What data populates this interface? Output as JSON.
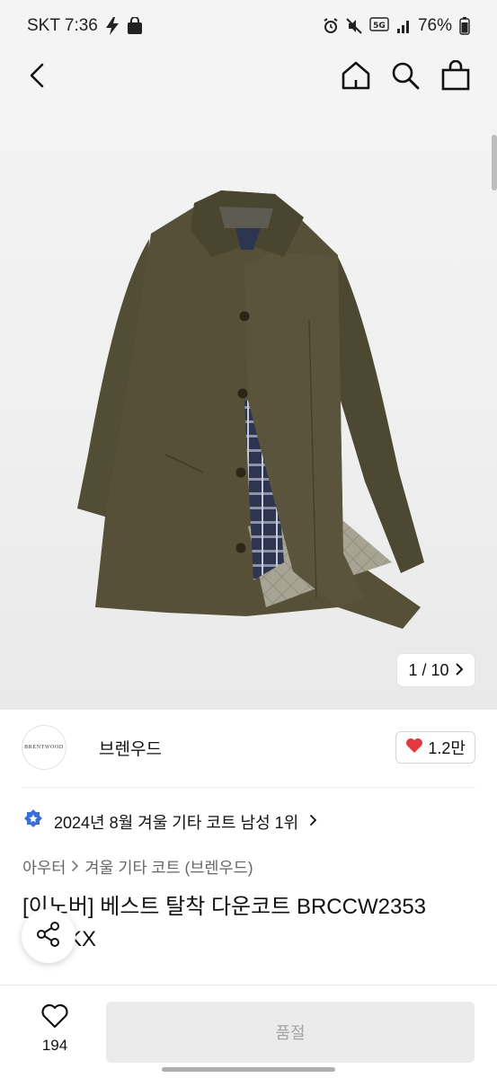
{
  "status_bar": {
    "carrier_time": "SKT 7:36",
    "battery": "76%",
    "icons": [
      "charging-bolt-icon",
      "bag-icon",
      "alarm-icon",
      "mute-icon",
      "5g-icon",
      "signal-icon",
      "battery-icon"
    ]
  },
  "nav": {
    "back_icon": "chevron-left-icon",
    "home_icon": "home-icon",
    "search_icon": "search-icon",
    "bag_icon": "shopping-bag-icon"
  },
  "gallery": {
    "counter": "1 / 10",
    "image_subject": "olive-green-coat"
  },
  "brand": {
    "logo_text": "BRENTWOOD",
    "name": "브렌우드",
    "likes": "1.2만"
  },
  "ranking": {
    "text": "2024년 8월 겨울 기타 코트 남성 1위"
  },
  "breadcrumb": [
    "아우터",
    "겨울 기타 코트 (브렌우드)"
  ],
  "product": {
    "title_line1": "[이노버] 베스트 탈착 다운코트 BRCCW2353",
    "title_line2": "KX"
  },
  "bottom_bar": {
    "wish_count": "194",
    "soldout_label": "품절"
  },
  "colors": {
    "heart": "#e03a3e",
    "badge": "#3b6fd8",
    "coat": "#4f4a33"
  }
}
